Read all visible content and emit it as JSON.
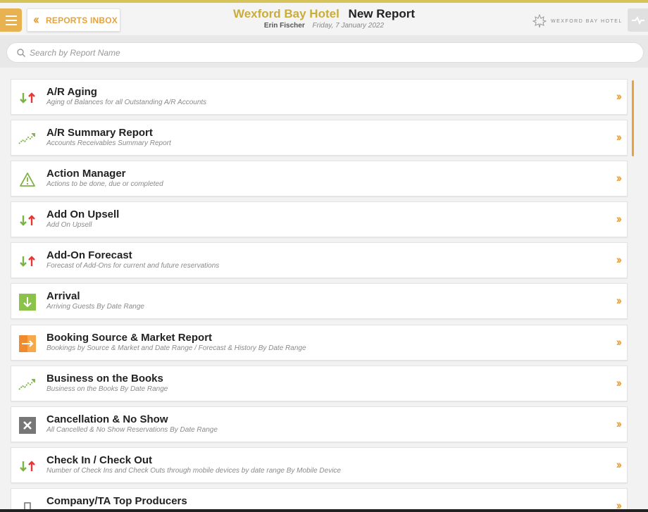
{
  "header": {
    "hotel_name": "Wexford Bay Hotel",
    "page_title": "New Report",
    "user_name": "Erin Fischer",
    "date": "Friday, 7 January 2022",
    "back_label": "REPORTS INBOX",
    "logo_text": "WEXFORD BAY HOTEL"
  },
  "search": {
    "placeholder": "Search by Report Name",
    "value": ""
  },
  "colors": {
    "accent": "#e9a23b",
    "hotel_gold": "#c9ad3b",
    "green": "#7cb342",
    "red": "#e53935"
  },
  "reports": [
    {
      "name": "A/R Aging",
      "desc": "Aging of Balances for all Outstanding A/R Accounts",
      "icon": "up-down-arrows-icon"
    },
    {
      "name": "A/R Summary Report",
      "desc": "Accounts Receivables Summary Report",
      "icon": "trend-line-icon"
    },
    {
      "name": "Action Manager",
      "desc": "Actions to be done, due or completed",
      "icon": "warning-triangle-icon"
    },
    {
      "name": "Add On Upsell",
      "desc": "Add On Upsell",
      "icon": "up-down-arrows-icon"
    },
    {
      "name": "Add-On Forecast",
      "desc": "Forecast of Add-Ons for current and future reservations",
      "icon": "up-down-arrows-icon"
    },
    {
      "name": "Arrival",
      "desc": "Arriving Guests By Date Range",
      "icon": "arrival-icon"
    },
    {
      "name": "Booking Source & Market Report",
      "desc": "Bookings by Source & Market and Date Range / Forecast & History By Date Range",
      "icon": "booking-source-icon"
    },
    {
      "name": "Business on the Books",
      "desc": "Business on the Books By Date Range",
      "icon": "trend-line-icon"
    },
    {
      "name": "Cancellation & No Show",
      "desc": "All Cancelled & No Show Reservations By Date Range",
      "icon": "cancel-x-icon"
    },
    {
      "name": "Check In / Check Out",
      "desc": "Number of Check Ins and Check Outs through mobile devices by date range By Mobile Device",
      "icon": "up-down-arrows-icon"
    },
    {
      "name": "Company/TA Top Producers",
      "desc": "",
      "icon": "building-icon"
    }
  ]
}
